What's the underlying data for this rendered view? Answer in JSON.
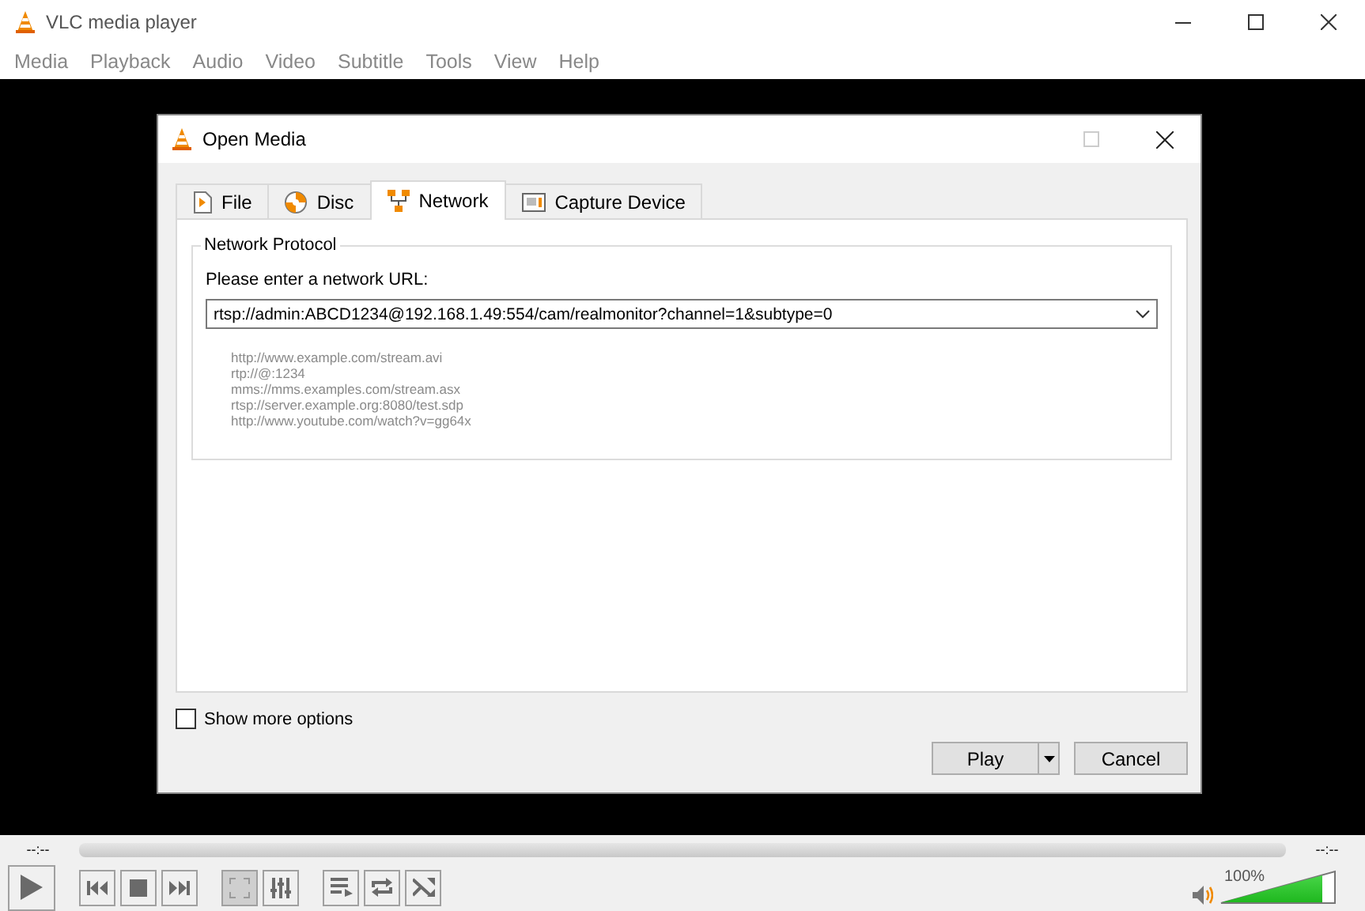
{
  "window": {
    "title": "VLC media player"
  },
  "menu": [
    "Media",
    "Playback",
    "Audio",
    "Video",
    "Subtitle",
    "Tools",
    "View",
    "Help"
  ],
  "dialog": {
    "title": "Open Media",
    "tabs": [
      {
        "label": "File",
        "kind": "file",
        "selected": false
      },
      {
        "label": "Disc",
        "kind": "disc",
        "selected": false
      },
      {
        "label": "Network",
        "kind": "network",
        "selected": true
      },
      {
        "label": "Capture Device",
        "kind": "capture",
        "selected": false
      }
    ],
    "group_title": "Network Protocol",
    "url_label": "Please enter a network URL:",
    "url_value": "rtsp://admin:ABCD1234@192.168.1.49:554/cam/realmonitor?channel=1&subtype=0",
    "examples": [
      "http://www.example.com/stream.avi",
      "rtp://@:1234",
      "mms://mms.examples.com/stream.asx",
      "rtsp://server.example.org:8080/test.sdp",
      "http://www.youtube.com/watch?v=gg64x"
    ],
    "show_more_options": {
      "label": "Show more options",
      "checked": false
    },
    "buttons": [
      {
        "label": "Play",
        "kind": "split"
      },
      {
        "label": "Cancel",
        "kind": "plain"
      }
    ]
  },
  "player": {
    "elapsed": "--:--",
    "remaining": "--:--",
    "control_groups": [
      [
        {
          "kind": "play",
          "disabled": false
        }
      ],
      [
        {
          "kind": "previous",
          "disabled": false
        },
        {
          "kind": "stop",
          "disabled": false
        },
        {
          "kind": "next",
          "disabled": false
        }
      ],
      [
        {
          "kind": "fullscreen",
          "disabled": true
        },
        {
          "kind": "equalizer",
          "disabled": false
        }
      ],
      [
        {
          "kind": "playlist",
          "disabled": false
        },
        {
          "kind": "loop",
          "disabled": false
        },
        {
          "kind": "shuffle",
          "disabled": false
        }
      ]
    ],
    "volume": {
      "reading": "100%",
      "level": 0.88
    }
  }
}
